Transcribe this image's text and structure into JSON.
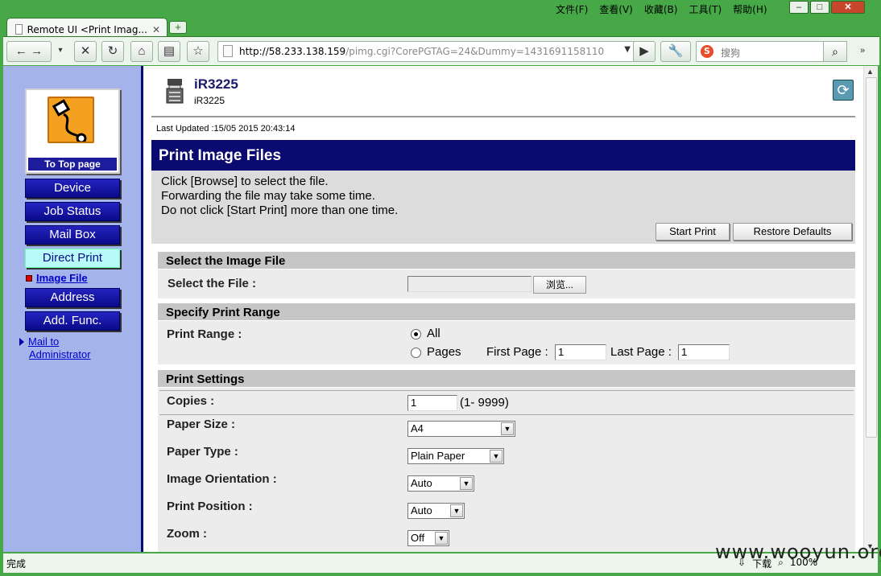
{
  "browser": {
    "menu": [
      "文件(F)",
      "查看(V)",
      "收藏(B)",
      "工具(T)",
      "帮助(H)"
    ],
    "tab_title": "Remote UI <Print Imag...",
    "url_host": "http://58.233.138.159",
    "url_rest": "/pimg.cgi?CorePGTAG=24&Dummy=1431691158110",
    "search_placeholder": "搜狗",
    "status": "完成",
    "status_right": "下载",
    "zoom": "100%",
    "watermark": "www.wooyun.org"
  },
  "sidebar": {
    "top_label": "To Top page",
    "items": [
      {
        "label": "Device"
      },
      {
        "label": "Job Status"
      },
      {
        "label": "Mail Box"
      },
      {
        "label": "Direct Print"
      },
      {
        "label": "Address"
      },
      {
        "label": "Add. Func."
      }
    ],
    "sub_link": "Image File",
    "mail_link_1": "Mail to",
    "mail_link_2": "Administrator"
  },
  "device": {
    "name": "iR3225",
    "model": "iR3225",
    "last_updated": "Last Updated :15/05 2015 20:43:14"
  },
  "page": {
    "title": "Print Image Files",
    "intro": [
      "Click [Browse] to select the file.",
      "Forwarding the file may take some time.",
      "Do not click [Start Print] more than one time."
    ],
    "start_print": "Start Print",
    "restore_defaults": "Restore Defaults"
  },
  "select_file": {
    "header": "Select the Image File",
    "label": "Select the File :",
    "browse": "浏览..."
  },
  "print_range": {
    "header": "Specify Print Range",
    "label": "Print Range :",
    "all": "All",
    "pages": "Pages",
    "first_page_label": "First Page :",
    "first_page_value": "1",
    "last_page_label": "Last Page :",
    "last_page_value": "1",
    "selected": "All"
  },
  "settings": {
    "header": "Print Settings",
    "copies_label": "Copies :",
    "copies_value": "1",
    "copies_range": "(1- 9999)",
    "paper_size_label": "Paper Size :",
    "paper_size_value": "A4",
    "paper_type_label": "Paper Type :",
    "paper_type_value": "Plain Paper",
    "orientation_label": "Image Orientation :",
    "orientation_value": "Auto",
    "position_label": "Print Position :",
    "position_value": "Auto",
    "zoom_label": "Zoom :",
    "zoom_value": "Off"
  }
}
